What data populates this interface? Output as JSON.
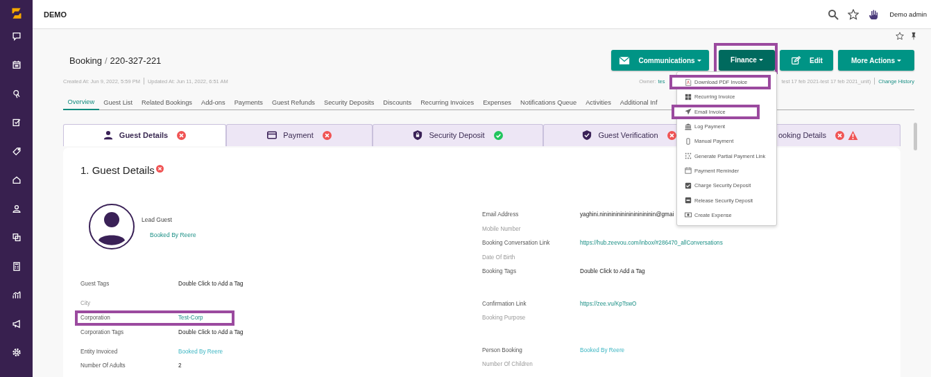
{
  "app": {
    "name": "DEMO",
    "user": "Demo admin"
  },
  "booking": {
    "root": "Booking",
    "separator": "/",
    "number": "220-327-221",
    "created": "Created At: Jun 9, 2022, 5:59 PM",
    "updated": "Updated At: Jun 11, 2022, 6:51 AM",
    "owner_label": "Owner:",
    "owner_value": "tes",
    "unit": "test 17 feb 2021-test 17 feb 2021_unit)",
    "history_link": "Change History"
  },
  "actions": [
    {
      "label": "Communications",
      "open": false,
      "highlighted": false
    },
    {
      "label": "Finance",
      "open": true,
      "highlighted": true
    },
    {
      "label": "Edit",
      "open": false,
      "highlighted": false
    },
    {
      "label": "More Actions",
      "open": false,
      "highlighted": false
    }
  ],
  "finance_menu": [
    {
      "label": "Download PDF Invoice",
      "highlighted": true
    },
    {
      "label": "Recurring Invoice",
      "highlighted": false
    },
    {
      "label": "Email Invoice",
      "highlighted": true
    },
    {
      "label": "Log Payment",
      "highlighted": false
    },
    {
      "label": "Manual Payment",
      "highlighted": false
    },
    {
      "label": "Generate Partial Payment Link",
      "highlighted": false
    },
    {
      "label": "Payment Reminder",
      "highlighted": false
    },
    {
      "label": "Charge Security Deposit",
      "highlighted": false
    },
    {
      "label": "Release Security Deposit",
      "highlighted": false
    },
    {
      "label": "Create Expense",
      "highlighted": false
    }
  ],
  "tabs": [
    {
      "label": "Overview",
      "selected": true
    },
    {
      "label": "Guest List",
      "selected": false
    },
    {
      "label": "Related Bookings",
      "selected": false
    },
    {
      "label": "Add-ons",
      "selected": false
    },
    {
      "label": "Payments",
      "selected": false
    },
    {
      "label": "Guest Refunds",
      "selected": false
    },
    {
      "label": "Security Deposits",
      "selected": false
    },
    {
      "label": "Discounts",
      "selected": false
    },
    {
      "label": "Recurring Invoices",
      "selected": false
    },
    {
      "label": "Expenses",
      "selected": false
    },
    {
      "label": "Notifications Queue",
      "selected": false
    },
    {
      "label": "Activities",
      "selected": false
    },
    {
      "label": "Additional Inf",
      "selected": false
    }
  ],
  "steps": [
    {
      "label": "Guest Details",
      "selected": true,
      "complete": false,
      "warning": false
    },
    {
      "label": "Payment",
      "selected": false,
      "complete": false,
      "warning": false
    },
    {
      "label": "Security Deposit",
      "selected": false,
      "complete": true,
      "warning": false
    },
    {
      "label": "Guest Verification",
      "selected": false,
      "complete": false,
      "warning": false
    },
    {
      "label": "ooking Details",
      "selected": false,
      "complete": false,
      "warning": true
    }
  ],
  "section": {
    "title": "1. Guest Details",
    "complete": false
  },
  "guest": {
    "role": "Lead Guest",
    "booked_by": "Booked By Reere"
  },
  "columns": [
    {
      "groups": [
        {
          "fields": [
            {
              "label": "Guest Tags",
              "value": "Double Click to Add a Tag",
              "kind": "text",
              "highlighted": false
            }
          ]
        },
        {
          "fields": [
            {
              "label": "City",
              "highlighted": false
            },
            {
              "label": "Corporation",
              "value": "Test-Corp",
              "kind": "link",
              "highlighted": true
            },
            {
              "label": "Corporation Tags",
              "value": "Double Click to Add a Tag",
              "kind": "text",
              "highlighted": false
            }
          ]
        },
        {
          "fields": [
            {
              "label": "Entity Invoiced",
              "value": "Booked By Reere",
              "kind": "link-light",
              "highlighted": false
            },
            {
              "label": "Number Of Adults",
              "value": "2",
              "kind": "text",
              "highlighted": false
            }
          ]
        }
      ]
    },
    {
      "groups": [
        {
          "fields": [
            {
              "label": "Email Address",
              "value": "yaghini.ninininininininininininin@gmai",
              "kind": "text",
              "highlighted": false
            },
            {
              "label": "Mobile Number",
              "highlighted": false
            },
            {
              "label": "Booking Conversation Link",
              "value": "https://hub.zeevou.com/inbox/#286470_allConversations",
              "kind": "link",
              "highlighted": false
            },
            {
              "label": "Date Of Birth",
              "highlighted": false
            },
            {
              "label": "Booking Tags",
              "value": "Double Click to Add a Tag",
              "kind": "text",
              "highlighted": false
            }
          ]
        },
        {
          "fields": [
            {
              "label": "Confirmation Link",
              "value": "https://zee.vu/KpTswO",
              "kind": "link",
              "highlighted": false
            },
            {
              "label": "Booking Purpose",
              "highlighted": false
            }
          ]
        },
        {
          "fields": [
            {
              "label": "Person Booking",
              "value": "Booked By Reere",
              "kind": "link-light",
              "highlighted": false
            },
            {
              "label": "Number Of Children",
              "highlighted": false
            }
          ]
        }
      ]
    }
  ]
}
